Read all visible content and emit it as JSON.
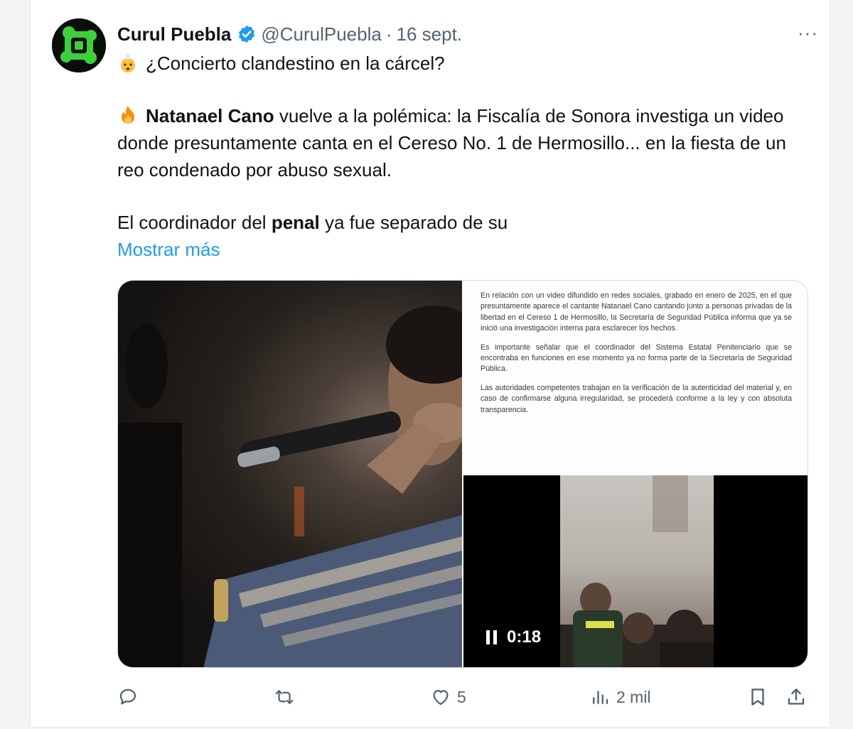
{
  "tweet": {
    "author_name": "Curul Puebla",
    "handle": "@CurulPuebla",
    "separator": "·",
    "date": "16 sept.",
    "more_label": "···",
    "line1": "¿Concierto clandestino en la cárcel?",
    "p2_bold": "Natanael Cano",
    "p2_rest": " vuelve a la polémica: la Fiscalía de Sonora investiga un video donde presuntamente canta en el Cereso No. 1 de Hermosillo... en la fiesta de un reo condenado por abuso sexual.",
    "p3_pre": "El coordinador del ",
    "p3_bold": "penal",
    "p3_post": " ya fue separado de su",
    "show_more": "Mostrar más"
  },
  "media": {
    "document_paragraphs": [
      "En relación con un video difundido en redes sociales, grabado en enero de 2025, en el que presuntamente aparece el cantante Natanael Cano cantando junto a personas privadas de la libertad en el Cereso 1 de Hermosillo, la Secretaría de Seguridad Pública informa que ya se inició una investigación interna para esclarecer los hechos.",
      "Es importante señalar que el coordinador del Sistema Estatal Penitenciario que se encontraba en funciones en ese momento ya no forma parte de la Secretaría de Seguridad Pública.",
      "Las autoridades competentes trabajan en la verificación de la autenticidad del material y, en caso de confirmarse alguna irregularidad, se procederá conforme a la ley y con absoluta transparencia."
    ],
    "video_time": "0:18"
  },
  "actions": {
    "reply_count": "",
    "retweet_count": "",
    "like_count": "5",
    "views_count": "2 mil"
  },
  "colors": {
    "link": "#1d9bf0",
    "secondary_text": "#536471",
    "verified": "#1d9bf0"
  },
  "icons": [
    "verified-badge-icon",
    "exploding-head-emoji-icon",
    "fire-emoji-icon",
    "reply-icon",
    "retweet-icon",
    "like-icon",
    "views-icon",
    "bookmark-icon",
    "share-icon",
    "pause-icon",
    "more-icon"
  ]
}
